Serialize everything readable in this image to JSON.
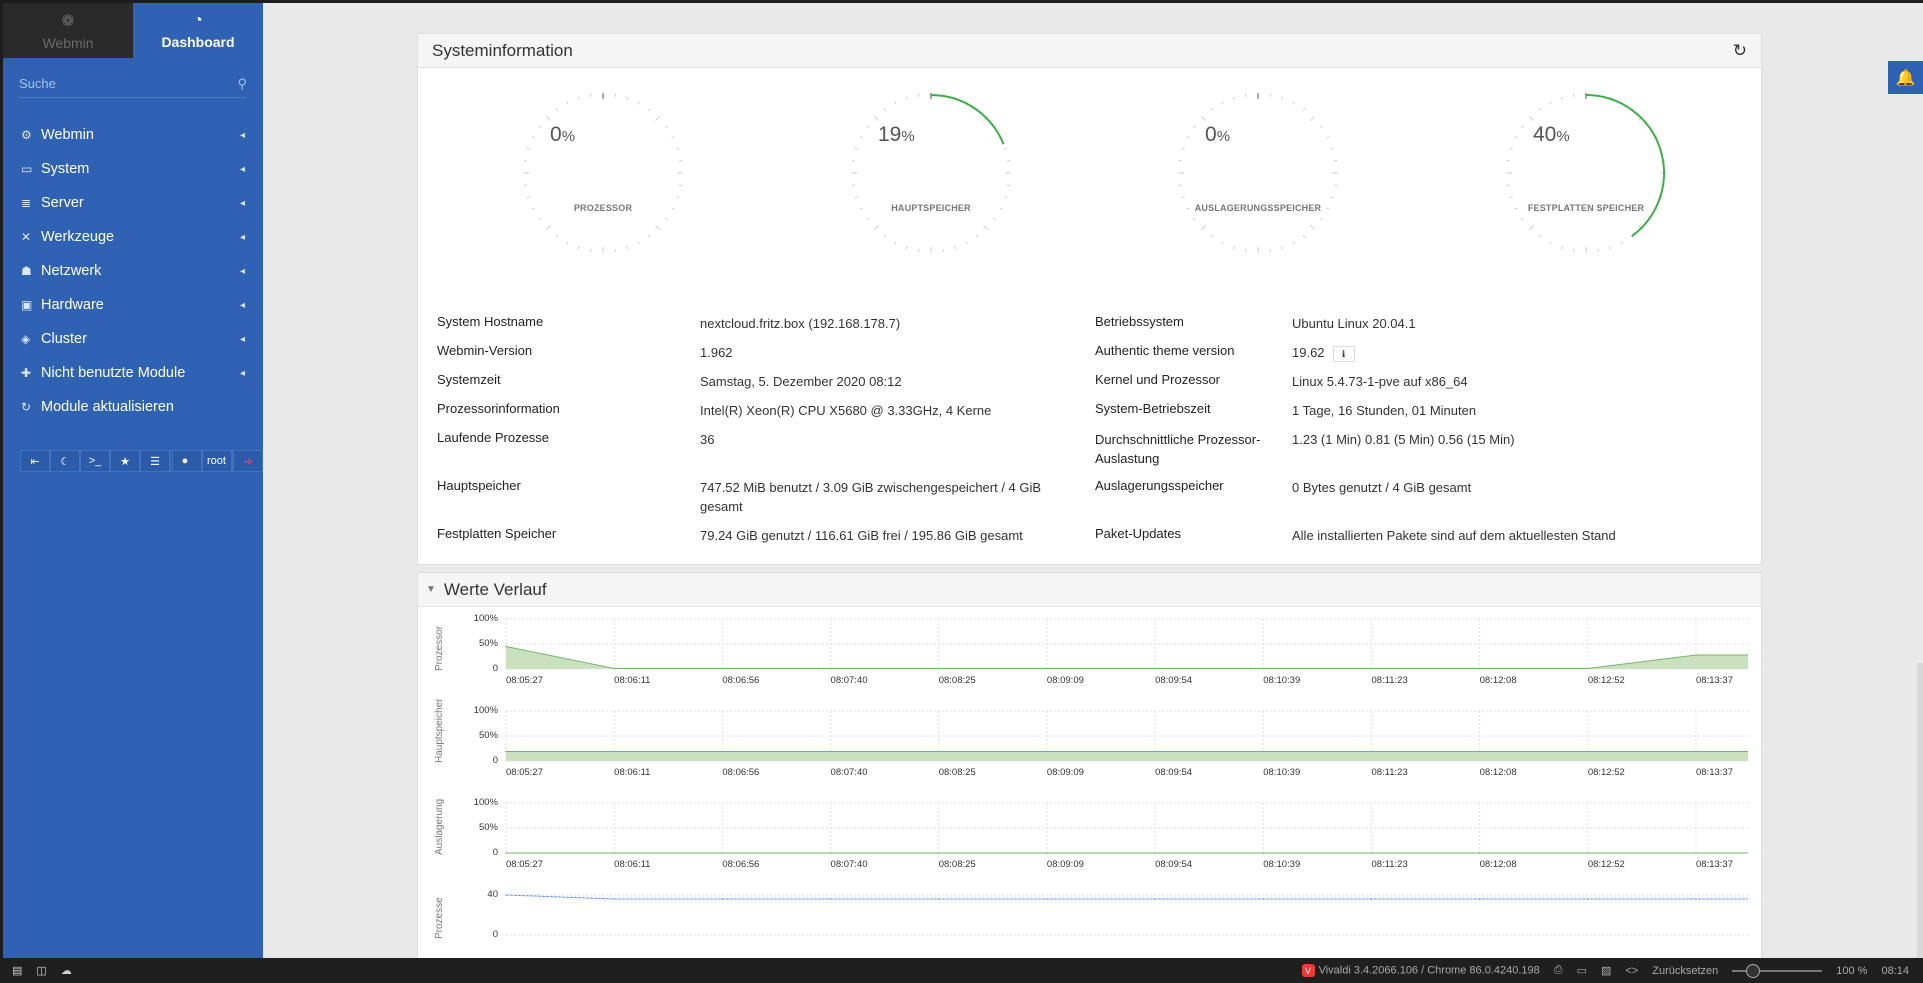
{
  "sidebar": {
    "tabs": [
      {
        "label": "Webmin",
        "icon": "webmin-logo-icon"
      },
      {
        "label": "Dashboard",
        "icon": "dashboard-icon"
      }
    ],
    "search_placeholder": "Suche",
    "items": [
      {
        "label": "Webmin",
        "icon": "gear-icon"
      },
      {
        "label": "System",
        "icon": "laptop-icon"
      },
      {
        "label": "Server",
        "icon": "server-icon"
      },
      {
        "label": "Werkzeuge",
        "icon": "tools-icon"
      },
      {
        "label": "Netzwerk",
        "icon": "network-icon"
      },
      {
        "label": "Hardware",
        "icon": "hdd-icon"
      },
      {
        "label": "Cluster",
        "icon": "layers-icon"
      },
      {
        "label": "Nicht benutzte Module",
        "icon": "puzzle-icon"
      },
      {
        "label": "Module aktualisieren",
        "icon": "refresh-icon"
      }
    ],
    "toolbar": {
      "user": "root"
    }
  },
  "sysinfo": {
    "title": "Systeminformation",
    "gauges": [
      {
        "value": "0",
        "unit": "%",
        "label": "PROZESSOR",
        "percent": 0
      },
      {
        "value": "19",
        "unit": "%",
        "label": "HAUPTSPEICHER",
        "percent": 19
      },
      {
        "value": "0",
        "unit": "%",
        "label": "AUSLAGERUNGSSPEICHER",
        "percent": 0
      },
      {
        "value": "40",
        "unit": "%",
        "label": "FESTPLATTEN SPEICHER",
        "percent": 40
      }
    ],
    "rows": [
      {
        "l1": "System Hostname",
        "v1": "nextcloud.fritz.box (192.168.178.7)",
        "l2": "Betriebssystem",
        "v2": "Ubuntu Linux 20.04.1"
      },
      {
        "l1": "Webmin-Version",
        "v1": "1.962",
        "l2": "Authentic theme version",
        "v2": "19.62"
      },
      {
        "l1": "Systemzeit",
        "v1": "Samstag, 5. Dezember 2020 08:12",
        "l2": "Kernel und Prozessor",
        "v2": "Linux 5.4.73-1-pve auf x86_64"
      },
      {
        "l1": "Prozessorinformation",
        "v1": "Intel(R) Xeon(R) CPU X5680 @ 3.33GHz, 4 Kerne",
        "l2": "System-Betriebszeit",
        "v2": "1 Tage, 16 Stunden, 01 Minuten"
      },
      {
        "l1": "Laufende Prozesse",
        "v1": "36",
        "l2": "Durchschnittliche Prozessor-Auslastung",
        "v2": "1.23 (1 Min) 0.81 (5 Min) 0.56 (15 Min)"
      },
      {
        "l1": "Hauptspeicher",
        "v1": "747.52 MiB benutzt / 3.09 GiB zwischengespeichert / 4 GiB gesamt",
        "l2": "Auslagerungsspeicher",
        "v2": "0 Bytes genutzt / 4 GiB gesamt"
      },
      {
        "l1": "Festplatten Speicher",
        "v1": "79.24 GiB genutzt / 116.61 GiB frei / 195.86 GiB gesamt",
        "l2": "Paket-Updates",
        "v2": "Alle installierten Pakete sind auf dem aktuellesten Stand"
      }
    ]
  },
  "history": {
    "title": "Werte Verlauf",
    "x_ticks": [
      "08:05:27",
      "08:06:11",
      "08:06:56",
      "08:07:40",
      "08:08:25",
      "08:09:09",
      "08:09:54",
      "08:10:39",
      "08:11:23",
      "08:12:08",
      "08:12:52",
      "08:13:37"
    ],
    "charts": [
      {
        "name": "Prozessor",
        "yticks": [
          "100%",
          "50%",
          "0"
        ]
      },
      {
        "name": "Hauptspeicher",
        "yticks": [
          "100%",
          "50%",
          "0"
        ]
      },
      {
        "name": "Auslagerung",
        "yticks": [
          "100%",
          "50%",
          "0"
        ]
      },
      {
        "name": "Prozesse",
        "yticks": [
          "40",
          "0"
        ]
      }
    ]
  },
  "chart_data": [
    {
      "type": "area",
      "ylabel": "Prozessor",
      "x": [
        "08:05:27",
        "08:06:11",
        "08:06:56",
        "08:07:40",
        "08:08:25",
        "08:09:09",
        "08:09:54",
        "08:10:39",
        "08:11:23",
        "08:12:08",
        "08:12:52",
        "08:13:37"
      ],
      "values": [
        45,
        1,
        1,
        1,
        1,
        1,
        1,
        1,
        1,
        1,
        1,
        28
      ],
      "ylim": [
        0,
        100
      ]
    },
    {
      "type": "area",
      "ylabel": "Hauptspeicher",
      "x": [
        "08:05:27",
        "08:06:11",
        "08:06:56",
        "08:07:40",
        "08:08:25",
        "08:09:09",
        "08:09:54",
        "08:10:39",
        "08:11:23",
        "08:12:08",
        "08:12:52",
        "08:13:37"
      ],
      "values": [
        19,
        19,
        19,
        19,
        19,
        19,
        19,
        19,
        19,
        19,
        19,
        19
      ],
      "ylim": [
        0,
        100
      ]
    },
    {
      "type": "area",
      "ylabel": "Auslagerung",
      "x": [
        "08:05:27",
        "08:06:11",
        "08:06:56",
        "08:07:40",
        "08:08:25",
        "08:09:09",
        "08:09:54",
        "08:10:39",
        "08:11:23",
        "08:12:08",
        "08:12:52",
        "08:13:37"
      ],
      "values": [
        0,
        0,
        0,
        0,
        0,
        0,
        0,
        0,
        0,
        0,
        0,
        0
      ],
      "ylim": [
        0,
        100
      ]
    },
    {
      "type": "line",
      "ylabel": "Prozesse",
      "x": [
        "08:05:27",
        "08:06:11",
        "08:06:56",
        "08:07:40",
        "08:08:25",
        "08:09:09",
        "08:09:54",
        "08:10:39",
        "08:11:23",
        "08:12:08",
        "08:12:52",
        "08:13:37"
      ],
      "values": [
        40,
        36,
        36,
        36,
        36,
        36,
        36,
        36,
        36,
        36,
        36,
        36
      ],
      "ylim": [
        0,
        40
      ]
    }
  ],
  "statusbar": {
    "browser": "Vivaldi 3.4.2066.106 / Chrome 86.0.4240.198",
    "reset": "Zurücksetzen",
    "zoom": "100 %",
    "time": "08:14"
  },
  "colors": {
    "sidebar": "#2f62b3",
    "gauge_arc": "#3dae49",
    "chart_fill": "#c9e1bf",
    "chart_line": "#78b36b",
    "process_line": "#6a8fd6"
  }
}
